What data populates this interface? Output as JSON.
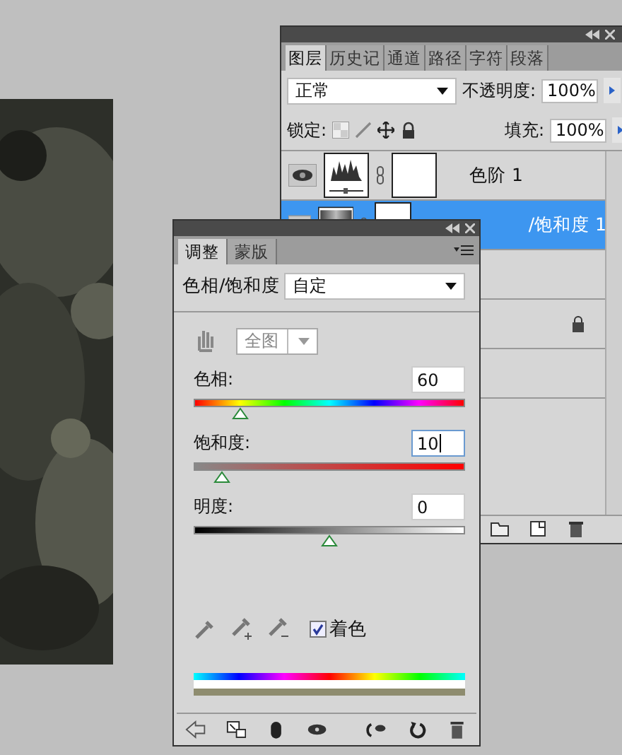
{
  "layers_panel": {
    "tabs": [
      {
        "label": "图层",
        "selected": true
      },
      {
        "label": "历史记",
        "selected": false
      },
      {
        "label": "通道",
        "selected": false
      },
      {
        "label": "路径",
        "selected": false
      },
      {
        "label": "字符",
        "selected": false
      },
      {
        "label": "段落",
        "selected": false
      }
    ],
    "blend_mode": "正常",
    "opacity_label": "不透明度:",
    "opacity": "100%",
    "lock_label": "锁定:",
    "fill_label": "填充:",
    "fill": "100%",
    "layers": [
      {
        "name": "色阶 1",
        "selected": false,
        "kind": "levels"
      },
      {
        "name": "/饱和度 1",
        "selected": true,
        "kind": "hue_saturation"
      },
      {
        "selected": false,
        "kind": "empty"
      },
      {
        "selected": false,
        "kind": "background"
      },
      {
        "selected": false,
        "kind": "empty"
      }
    ]
  },
  "adjust_panel": {
    "tabs": [
      {
        "label": "调整",
        "selected": true
      },
      {
        "label": "蒙版",
        "selected": false
      }
    ],
    "adjustment": "色相/饱和度",
    "preset": "自定",
    "channel": {
      "value": "全图",
      "disabled": true
    },
    "sliders": [
      {
        "label": "色相:",
        "value": "60",
        "level": 0.167,
        "kind": "hue",
        "focused": false
      },
      {
        "label": "饱和度:",
        "value": "10",
        "level": 0.1,
        "kind": "saturation",
        "focused": true
      },
      {
        "label": "明度:",
        "value": "0",
        "level": 0.5,
        "kind": "lightness",
        "focused": false
      }
    ],
    "colorize": {
      "label": "着色",
      "checked": true
    }
  }
}
